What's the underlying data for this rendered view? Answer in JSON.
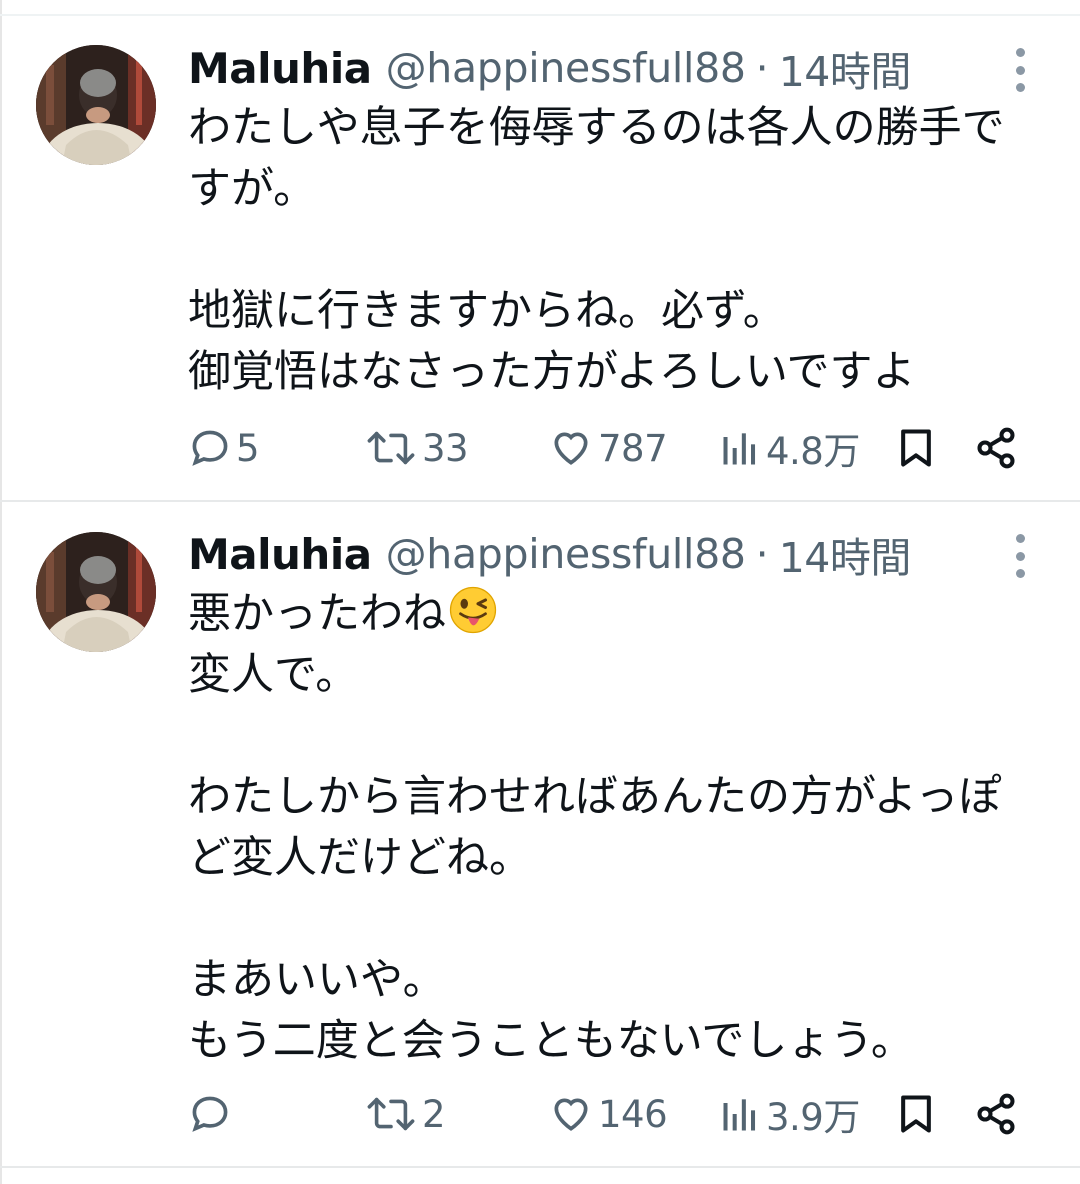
{
  "tweets": [
    {
      "name": "Maluhia",
      "handle": "@happinessfull88",
      "separator": "·",
      "time": "14時間",
      "lines": [
        "わたしや息子を侮辱するのは各人の勝手で",
        "すが。",
        "",
        "地獄に行きますからね。必ず。",
        "御覚悟はなさった方がよろしいですよ"
      ],
      "replies": "5",
      "retweets": "33",
      "likes": "787",
      "views": "4.8万"
    },
    {
      "name": "Maluhia",
      "handle": "@happinessfull88",
      "separator": "·",
      "time": "14時間",
      "lines": [
        "悪かったわね",
        "変人で。",
        "",
        "わたしから言わせればあんたの方がよっぽ",
        "ど変人だけどね。",
        "",
        "まあいいや。",
        "もう二度と会うこともないでしょう。"
      ],
      "emoji": "winking-face-with-tongue",
      "replies": "",
      "retweets": "2",
      "likes": "146",
      "views": "3.9万"
    }
  ],
  "icons": {
    "reply": "reply-icon",
    "retweet": "retweet-icon",
    "like": "heart-icon",
    "views": "views-icon",
    "bookmark": "bookmark-icon",
    "share": "share-icon",
    "more": "more-icon"
  },
  "colors": {
    "text": "#0f1419",
    "secondary": "#536471",
    "divider": "#e7e9ea"
  }
}
